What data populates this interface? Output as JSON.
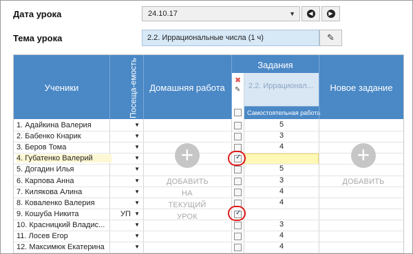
{
  "form": {
    "date_label": "Дата урока",
    "date_value": "24.10.17",
    "topic_label": "Тема урока",
    "topic_value": "2.2. Иррациональные числа (1 ч)"
  },
  "table": {
    "header_students": "Ученики",
    "header_attendance": "Посеща-емость",
    "header_homework": "Домашняя работа",
    "header_tasks": "Задания",
    "task_title": "2.2. Иррационал...",
    "task_type": "Самостоятельная работа",
    "header_new_task": "Новое задание",
    "add_to_lesson": "ДОБАВИТЬ НА ТЕКУЩИЙ УРОК",
    "add": "ДОБАВИТЬ",
    "rows": [
      {
        "name": "1. Адайкина Валерия",
        "attendance": "",
        "checked": false,
        "grade": "5"
      },
      {
        "name": "2. Бабенко Кнарик",
        "attendance": "",
        "checked": false,
        "grade": "3"
      },
      {
        "name": "3. Беров Тома",
        "attendance": "",
        "checked": false,
        "grade": "4"
      },
      {
        "name": "4. Губатенко Валерий",
        "attendance": "",
        "checked": true,
        "grade": ""
      },
      {
        "name": "5. Догадин Илья",
        "attendance": "",
        "checked": false,
        "grade": "5"
      },
      {
        "name": "6. Карпова Анна",
        "attendance": "",
        "checked": false,
        "grade": "3"
      },
      {
        "name": "7. Килякова Алина",
        "attendance": "",
        "checked": false,
        "grade": "4"
      },
      {
        "name": "8. Коваленко Валерия",
        "attendance": "",
        "checked": false,
        "grade": "4"
      },
      {
        "name": "9. Кошуба Никита",
        "attendance": "УП",
        "checked": true,
        "grade": ""
      },
      {
        "name": "10. Красницкий Владис...",
        "attendance": "",
        "checked": false,
        "grade": "3"
      },
      {
        "name": "11. Лосев Егор",
        "attendance": "",
        "checked": false,
        "grade": "4"
      },
      {
        "name": "12. Максимюк Екатерина",
        "attendance": "",
        "checked": false,
        "grade": "4"
      }
    ]
  },
  "icons": {
    "date_prev": "circle-arrow-left-icon",
    "date_next": "circle-arrow-right-icon",
    "edit": "pencil-icon",
    "delete_task": "close-icon",
    "edit_task": "pencil-icon",
    "add": "plus-circle-icon"
  },
  "colors": {
    "header_blue": "#4a88c6",
    "topic_bg": "#d7e8f7",
    "highlight_row": "#fdf8d4",
    "annotation_red": "#e01818"
  }
}
